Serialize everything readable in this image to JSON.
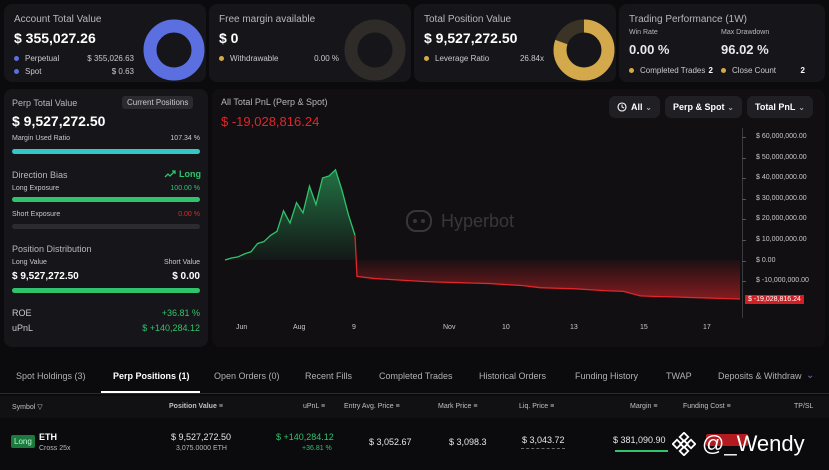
{
  "account": {
    "title": "Account Total Value",
    "value": "$ 355,027.26",
    "perpetual_label": "Perpetual",
    "perpetual_value": "$ 355,026.63",
    "spot_label": "Spot",
    "spot_value": "$ 0.63"
  },
  "margin": {
    "title": "Free margin available",
    "value": "$ 0",
    "withdrawable_label": "Withdrawable",
    "withdrawable_value": "0.00 %"
  },
  "position": {
    "title": "Total Position Value",
    "value": "$ 9,527,272.50",
    "leverage_label": "Leverage Ratio",
    "leverage_value": "26.84x"
  },
  "performance": {
    "title": "Trading Performance (1W)",
    "win_rate_label": "Win Rate",
    "win_rate": "0.00 %",
    "max_drawdown_label": "Max Drawdown",
    "max_drawdown": "96.02 %",
    "completed_label": "Completed Trades",
    "completed": "2",
    "close_label": "Close Count",
    "close": "2"
  },
  "perp": {
    "title": "Perp Total Value",
    "badge": "Current Positions",
    "value": "$ 9,527,272.50",
    "margin_used_label": "Margin Used Ratio",
    "margin_used": "107.34 %",
    "margin_used_fraction": 1.0
  },
  "bias": {
    "title": "Direction Bias",
    "direction": "Long",
    "long_label": "Long Exposure",
    "long_value": "100.00 %",
    "long_fraction": 1.0,
    "short_label": "Short Exposure",
    "short_value": "0.00 %",
    "short_fraction": 0.0
  },
  "distribution": {
    "title": "Position Distribution",
    "long_label": "Long Value",
    "long_value": "$ 9,527,272.50",
    "short_label": "Short Value",
    "short_value": "$ 0.00",
    "long_fraction": 1.0
  },
  "roe": {
    "label": "ROE",
    "value": "+36.81 %",
    "upnl_label": "uPnL",
    "upnl_value": "$ +140,284.12"
  },
  "chart_header": {
    "title": "All Total PnL (Perp & Spot)",
    "value": "$ -19,028,816.24",
    "filter_all": "All",
    "filter_scope": "Perp & Spot",
    "filter_metric": "Total PnL"
  },
  "watermark": "Hyperbot",
  "chart_data": {
    "type": "area",
    "x_labels": [
      "Jun",
      "Aug",
      "9",
      "Nov",
      "10",
      "13",
      "15",
      "17"
    ],
    "y_ticks": [
      "$ 60,000,000.00",
      "$ 50,000,000.00",
      "$ 40,000,000.00",
      "$ 30,000,000.00",
      "$ 20,000,000.00",
      "$ 10,000,000.00",
      "$ 0.00",
      "$ -10,000,000.00"
    ],
    "ylim": [
      -19028816.24,
      60000000
    ],
    "last_value_label": "$ -19,028,816.24",
    "values": [
      0,
      1000000,
      1500000,
      3000000,
      4000000,
      8000000,
      9000000,
      12000000,
      14000000,
      24000000,
      18000000,
      28000000,
      23000000,
      36000000,
      27000000,
      40000000,
      41000000,
      44000000,
      34000000,
      22000000,
      12000000,
      -8000000,
      -9000000,
      -9500000,
      -10000000,
      -10500000,
      -10800000,
      -11000000,
      -11300000,
      -11500000,
      -12000000,
      -12500000,
      -13500000,
      -13800000,
      -14000000,
      -14500000,
      -15000000,
      -15300000,
      -17500000,
      -17800000,
      -18000000,
      -18300000,
      -18500000,
      -18800000,
      -19028816.24
    ],
    "colors": {
      "positive": "#2fc36b",
      "negative": "#e0262a"
    }
  },
  "tabs": [
    "Spot Holdings (3)",
    "Perp Positions (1)",
    "Open Orders (0)",
    "Recent Fills",
    "Completed Trades",
    "Historical Orders",
    "Funding History",
    "TWAP",
    "Deposits & Withdraw"
  ],
  "table": {
    "headers": [
      "Symbol",
      "Position Value",
      "uPnL",
      "Entry Avg. Price",
      "Mark Price",
      "Liq. Price",
      "Margin",
      "Funding Cost",
      "TP/SL"
    ],
    "row": {
      "side": "Long",
      "symbol": "ETH",
      "leverage": "Cross 25x",
      "position_value": "$ 9,527,272.50",
      "position_size": "3,075.0000 ETH",
      "upnl": "$ +140,284.12",
      "upnl_pct": "+36.81 %",
      "entry": "$ 3,052.67",
      "mark": "$ 3,098.3",
      "liq": "$ 3,043.72",
      "margin": "$ 381,090.90"
    }
  },
  "credit": "@_Wendy",
  "colors": {
    "green": "#2fc36b",
    "red": "#e0262a",
    "blue": "#5b6fe0",
    "gold": "#d4a94b",
    "teal": "#35c7c7"
  }
}
